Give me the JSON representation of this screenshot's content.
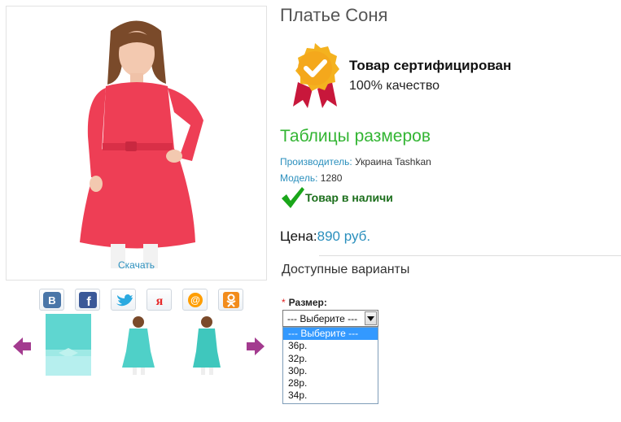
{
  "product": {
    "title": "Платье Соня",
    "download_label": "Скачать"
  },
  "certificate": {
    "title": "Товар сертифицирован",
    "subtitle": "100% качество"
  },
  "size_tables_link": "Таблицы размеров",
  "meta": {
    "manufacturer_key": "Производитель:",
    "manufacturer_value": " Украина Tashkan",
    "model_key": "Модель:",
    "model_value": " 1280"
  },
  "stock_status": "Товар в наличи",
  "price": {
    "label": "Цена:",
    "value": "890 руб."
  },
  "variants": {
    "title": "Доступные варианты",
    "required_mark": "*",
    "size_label": "Размер:",
    "selected": "--- Выберите ---",
    "options": [
      "--- Выберите ---",
      "36р.",
      "32р.",
      "30р.",
      "28р.",
      "34р."
    ]
  },
  "share_icons": [
    "vk-icon",
    "facebook-icon",
    "twitter-icon",
    "yandex-icon",
    "mailru-icon",
    "odnoklassniki-icon"
  ],
  "colors": {
    "accent_blue": "#2a8fbd",
    "green": "#33b533",
    "dress_red": "#ee3e55",
    "dress_teal": "#4fd0c8",
    "arrow_purple": "#a33b8f"
  }
}
